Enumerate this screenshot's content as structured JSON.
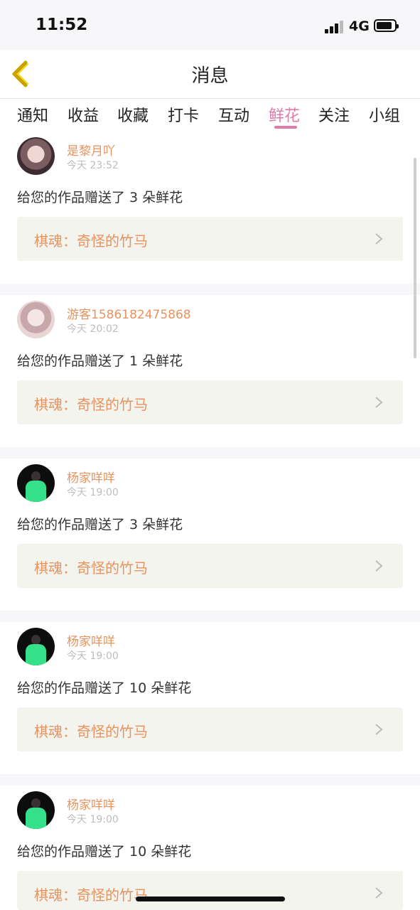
{
  "status_bar": {
    "time": "11:52",
    "network": "4G"
  },
  "nav": {
    "title": "消息"
  },
  "tabs": [
    {
      "label": "通知"
    },
    {
      "label": "收益"
    },
    {
      "label": "收藏"
    },
    {
      "label": "打卡"
    },
    {
      "label": "互动"
    },
    {
      "label": "鲜花",
      "active": true
    },
    {
      "label": "关注"
    },
    {
      "label": "小组"
    }
  ],
  "colors": {
    "accent": "#e07baa",
    "username": "#e8935f",
    "link_bg": "#f4f4ee"
  },
  "messages": [
    {
      "user": "是黎月吖",
      "time": "今天 23:52",
      "text": "给您的作品赠送了 3 朵鲜花",
      "work": "棋魂：奇怪的竹马"
    },
    {
      "user": "游客1586182475868",
      "time": "今天 20:02",
      "text": "给您的作品赠送了 1 朵鲜花",
      "work": "棋魂：奇怪的竹马"
    },
    {
      "user": "杨家咩咩",
      "time": "今天 19:00",
      "text": "给您的作品赠送了 3 朵鲜花",
      "work": "棋魂：奇怪的竹马"
    },
    {
      "user": "杨家咩咩",
      "time": "今天 19:00",
      "text": "给您的作品赠送了 10 朵鲜花",
      "work": "棋魂：奇怪的竹马"
    },
    {
      "user": "杨家咩咩",
      "time": "今天 19:00",
      "text": "给您的作品赠送了 10 朵鲜花",
      "work": "棋魂：奇怪的竹马"
    }
  ]
}
